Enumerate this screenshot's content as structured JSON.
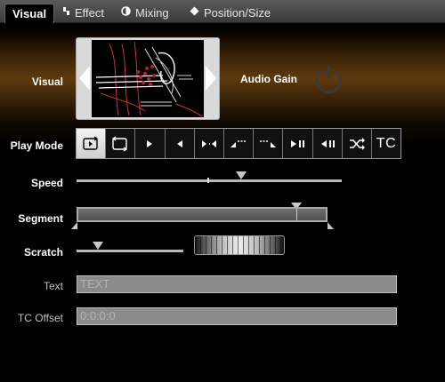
{
  "tabs": [
    {
      "label": "Visual",
      "icon": "none",
      "active": true
    },
    {
      "label": "Effect",
      "icon": "effect-icon"
    },
    {
      "label": "Mixing",
      "icon": "mixing-icon"
    },
    {
      "label": "Position/Size",
      "icon": "diamond-icon"
    }
  ],
  "visual": {
    "label": "Visual"
  },
  "audio_gain": {
    "label": "Audio Gain"
  },
  "play_mode": {
    "label": "Play Mode",
    "buttons": [
      "loop",
      "loop-alt",
      "play",
      "reverse",
      "ping-pong",
      "ramp-up",
      "ramp-down",
      "play-pause",
      "reverse-pause",
      "shuffle",
      "TC"
    ],
    "active_index": 0
  },
  "speed": {
    "label": "Speed",
    "value": 0.62
  },
  "segment": {
    "label": "Segment",
    "marker": 0.88
  },
  "scratch": {
    "label": "Scratch",
    "value": 0.2
  },
  "text": {
    "label": "Text",
    "value": "TEXT"
  },
  "tc_offset": {
    "label": "TC Offset",
    "value": "0:0:0:0"
  }
}
